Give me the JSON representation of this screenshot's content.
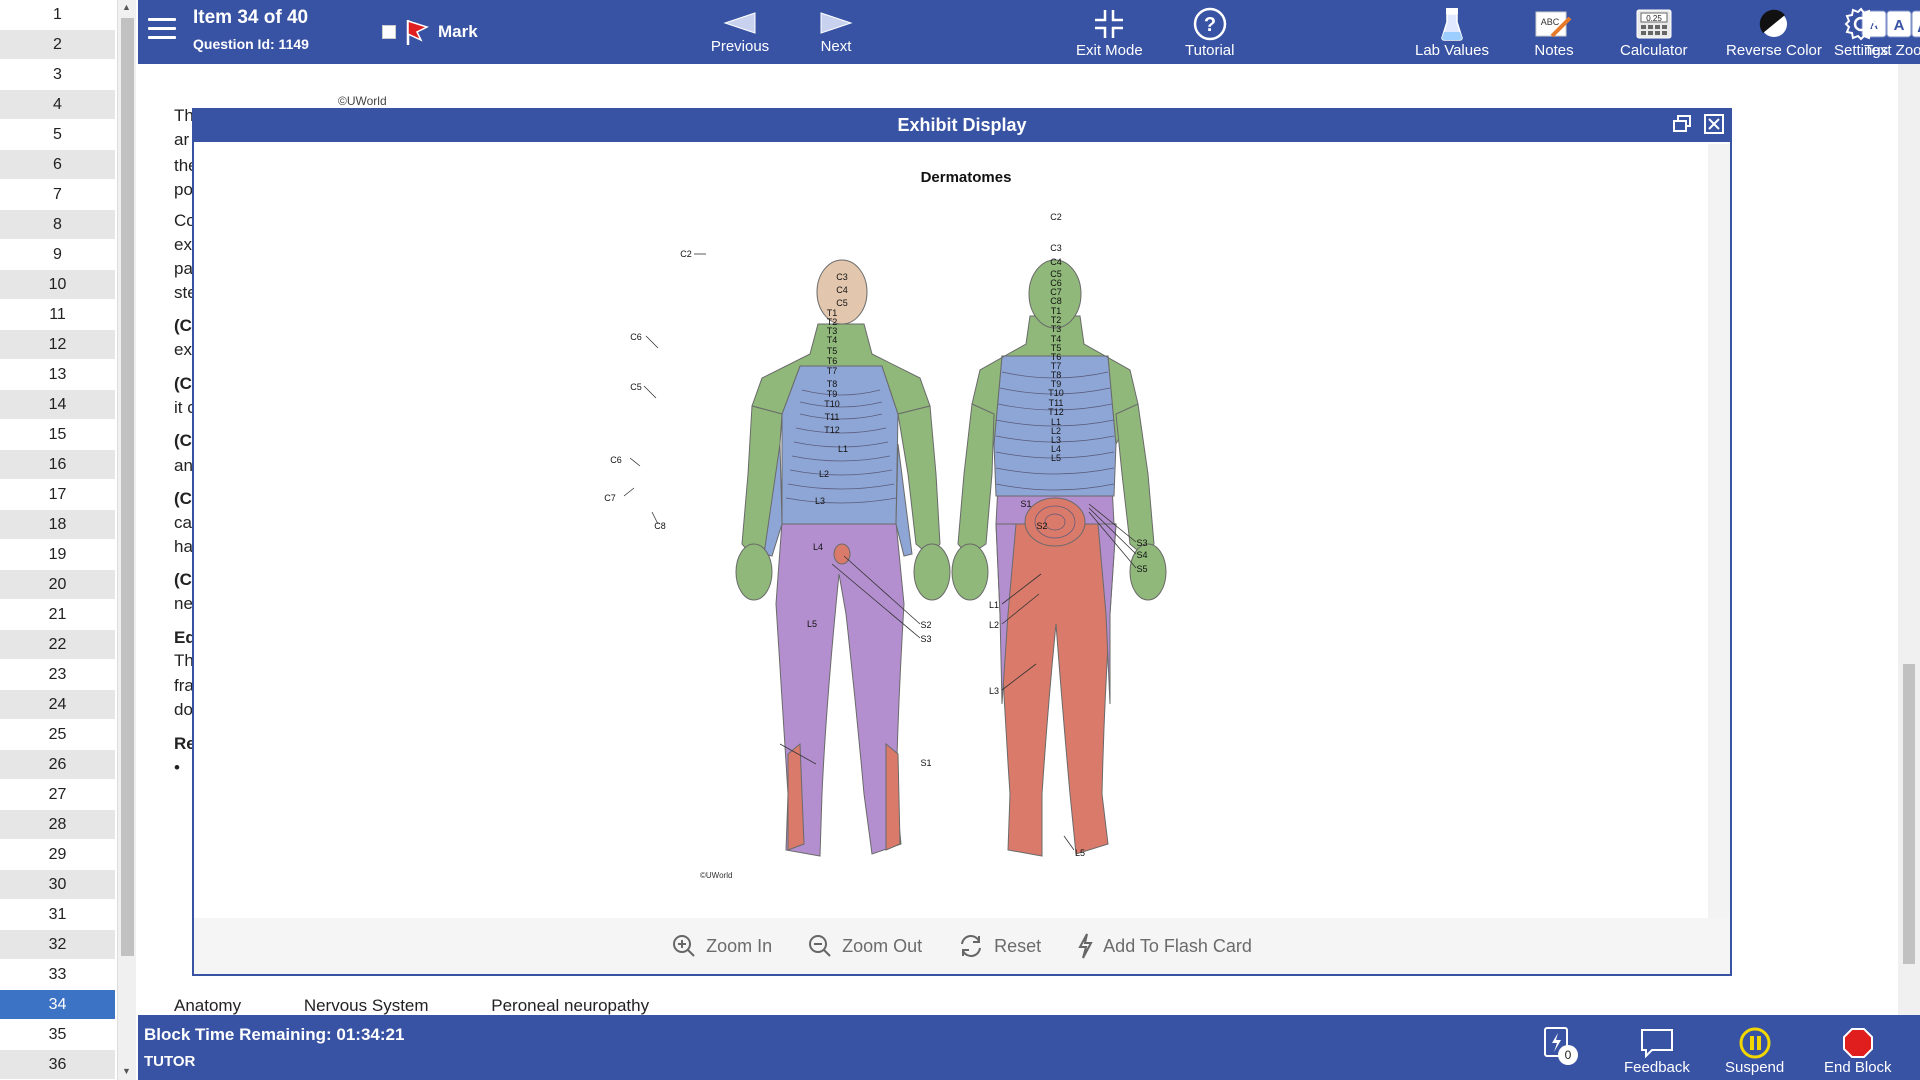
{
  "question_list": {
    "items": [
      "1",
      "2",
      "3",
      "4",
      "5",
      "6",
      "7",
      "8",
      "9",
      "10",
      "11",
      "12",
      "13",
      "14",
      "15",
      "16",
      "17",
      "18",
      "19",
      "20",
      "21",
      "22",
      "23",
      "24",
      "25",
      "26",
      "27",
      "28",
      "29",
      "30",
      "31",
      "32",
      "33",
      "34",
      "35",
      "36"
    ],
    "active_index": 33
  },
  "topbar": {
    "item_label": "Item 34 of 40",
    "question_id": "Question Id: 1149",
    "mark_label": "Mark",
    "previous_label": "Previous",
    "next_label": "Next",
    "tools": {
      "exit_mode": "Exit Mode",
      "tutorial": "Tutorial",
      "lab_values": "Lab Values",
      "notes": "Notes",
      "calculator": "Calculator",
      "reverse_color": "Reverse Color",
      "text_zoom": "Text Zoom",
      "settings": "Settings"
    },
    "calculator_display": "0.25",
    "notes_glyph": "ABC"
  },
  "content": {
    "copyright_top": "©UWorld",
    "fragments": [
      "Th",
      "ar",
      "the",
      "po",
      "Co",
      "ex",
      "pa",
      "ste",
      "(C",
      "ex",
      "(C",
      "it c",
      "(C",
      "an",
      "(C",
      "ca",
      "ha",
      "(C",
      "ne",
      "Ed",
      "Th",
      "fra",
      "do",
      "Re",
      "•"
    ],
    "tags": [
      "Anatomy",
      "Nervous System",
      "Peroneal neuropathy"
    ]
  },
  "exhibit": {
    "title": "Exhibit Display",
    "figure_title": "Dermatomes",
    "copyright": "©UWorld",
    "front_labels": {
      "c2": "C2",
      "c3": "C3",
      "c4": "C4",
      "c5": "C5",
      "t1": "T1",
      "t2": "T2",
      "t3": "T3",
      "t4": "T4",
      "t5": "T5",
      "t6": "T6",
      "t7": "T7",
      "t8": "T8",
      "t9": "T9",
      "t10": "T10",
      "t11": "T11",
      "t12": "T12",
      "l1": "L1",
      "l2": "L2",
      "l3": "L3",
      "l4": "L4",
      "l5": "L5",
      "c6a": "C6",
      "c5b": "C5",
      "c6b": "C6",
      "c7": "C7",
      "c8": "C8",
      "s2": "S2",
      "s3": "S3",
      "s1": "S1"
    },
    "back_labels": {
      "c2": "C2",
      "c3": "C3",
      "c4": "C4",
      "c5": "C5",
      "c6": "C6",
      "c7": "C7",
      "c8": "C8",
      "t1": "T1",
      "t2": "T2",
      "t3": "T3",
      "t4": "T4",
      "t5": "T5",
      "t6": "T6",
      "t7": "T7",
      "t8": "T8",
      "t9": "T9",
      "t10": "T10",
      "t11": "T11",
      "t12": "T12",
      "l1": "L1",
      "l2": "L2",
      "l3": "L3",
      "l4": "L4",
      "l5": "L5",
      "s1": "S1",
      "s2": "S2",
      "s3": "S3",
      "s4": "S4",
      "s5": "S5",
      "l1p": "L1",
      "l2p": "L2",
      "l3p": "L3",
      "l5p": "L5"
    },
    "toolbar": {
      "zoom_in": "Zoom In",
      "zoom_out": "Zoom Out",
      "reset": "Reset",
      "flash_card": "Add To Flash Card"
    },
    "colors": {
      "cervical": "#8fb87a",
      "thoracic": "#8ea6d6",
      "lumbar": "#b48fcf",
      "sacral": "#d97a6a",
      "head": "#e2c6ad"
    }
  },
  "bottombar": {
    "timer": "Block Time Remaining: 01:34:21",
    "mode": "TUTOR",
    "flash_count": "0",
    "feedback": "Feedback",
    "suspend": "Suspend",
    "end_block": "End Block"
  },
  "colors": {
    "bar": "#3852a4",
    "active_item": "#3d73c4",
    "end_red": "#e01e1e",
    "suspend_yellow": "#f2d600"
  }
}
